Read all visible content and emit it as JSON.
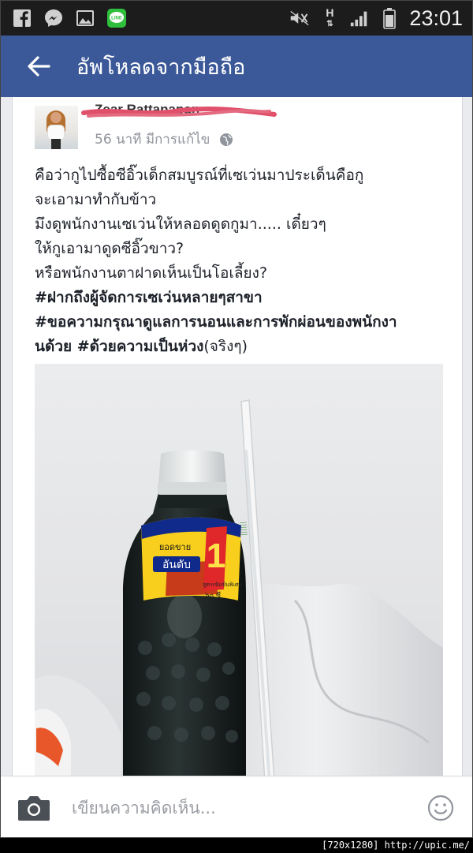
{
  "status_bar": {
    "time": "23:01",
    "network_label_top": "H",
    "icons_left": [
      "facebook-icon",
      "messenger-icon",
      "gallery-icon",
      "line-app-icon"
    ],
    "line_icon_text": "LINE",
    "icons_right": [
      "mute-icon",
      "hsdpa-icon",
      "signal-icon",
      "battery-icon"
    ]
  },
  "app_bar": {
    "title": "อัพโหลดจากมือถือ",
    "back_icon": "arrow-back-icon",
    "color": "#3b5998"
  },
  "post": {
    "author": "Zear Rattanapan",
    "time_ago": "56 นาที มีการแก้ไข",
    "privacy_icon": "globe-icon",
    "text_lines": [
      {
        "text": "คือว่ากูไปซื้อซีอิ๊วเด็กสมบูรณ์ที่เซเว่นมาประเด็นคือกู",
        "bold": false
      },
      {
        "text": "จะเอามาทำกับข้าว",
        "bold": false
      },
      {
        "text": "มึงดูพนักงานเซเว่นให้หลอดดูดกูมา..... เดี๋ยวๆ",
        "bold": false
      },
      {
        "text": "ให้กูเอามาดูดซีอิ๊วขาว?",
        "bold": false
      },
      {
        "text": "หรือพนักงานตาฝาดเห็นเป็นโอเลี้ยง?",
        "bold": false
      },
      {
        "text": "#ฝากถึงผู้จัดการเซเว่นหลายๆสาขา",
        "bold": true
      },
      {
        "text": "#ขอความกรุณาดูแลการนอนและการพักผ่อนของพนักงา",
        "bold": true
      }
    ],
    "last_line_bold": "นด้วย #ด้วยความเป็นห่วง",
    "last_line_normal": "(จริงๆ)",
    "photo": {
      "label_main": "อันดับ",
      "label_number": "1",
      "label_top": "ยอดขาย",
      "label_volume": "๖๐ ซี",
      "label_sub": "สูตรเข้มข้นพิเศษ"
    }
  },
  "comment_bar": {
    "placeholder": "เขียนความคิดเห็น...",
    "camera_icon": "camera-icon",
    "emoji_icon": "smiley-icon"
  },
  "watermark": "[720x1280] http://upic.me/"
}
